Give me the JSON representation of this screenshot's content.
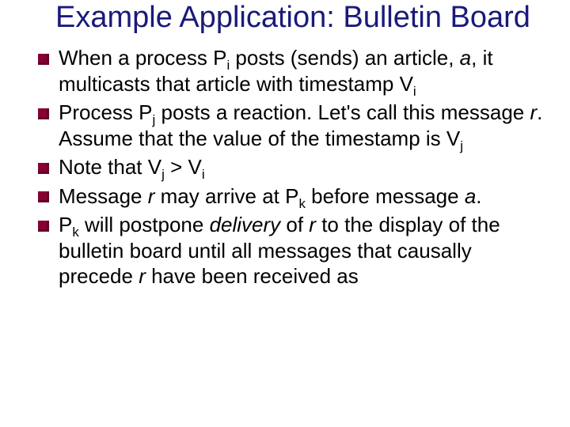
{
  "title": "Example Application: Bulletin Board",
  "bullets": [
    {
      "pre1": "When a process P",
      "sub1": "i",
      "mid1": " posts (sends) an article, ",
      "ital1": "a",
      "mid2": ", it multicasts that article with timestamp V",
      "sub2": "i"
    },
    {
      "pre1": "Process P",
      "sub1": "j",
      "mid1": " posts a reaction. Let's call this message ",
      "ital1": "r",
      "mid2": ". Assume that the value of the timestamp is V",
      "sub2": "j"
    },
    {
      "pre1": "Note that V",
      "sub1": "j",
      "mid1": " > V",
      "sub2": "i"
    },
    {
      "pre1": "Message ",
      "ital1": "r",
      "mid1": " may arrive at P",
      "sub1": "k",
      "mid2": " before message ",
      "ital2": "a",
      "post": "."
    },
    {
      "pre1": "P",
      "sub1": "k",
      "mid1": " will postpone ",
      "ital1": "delivery",
      "mid2": " of ",
      "ital2": "r",
      "mid3": " to the display of the bulletin board until all messages that causally precede ",
      "ital3": "r",
      "post": " have been received as"
    }
  ]
}
